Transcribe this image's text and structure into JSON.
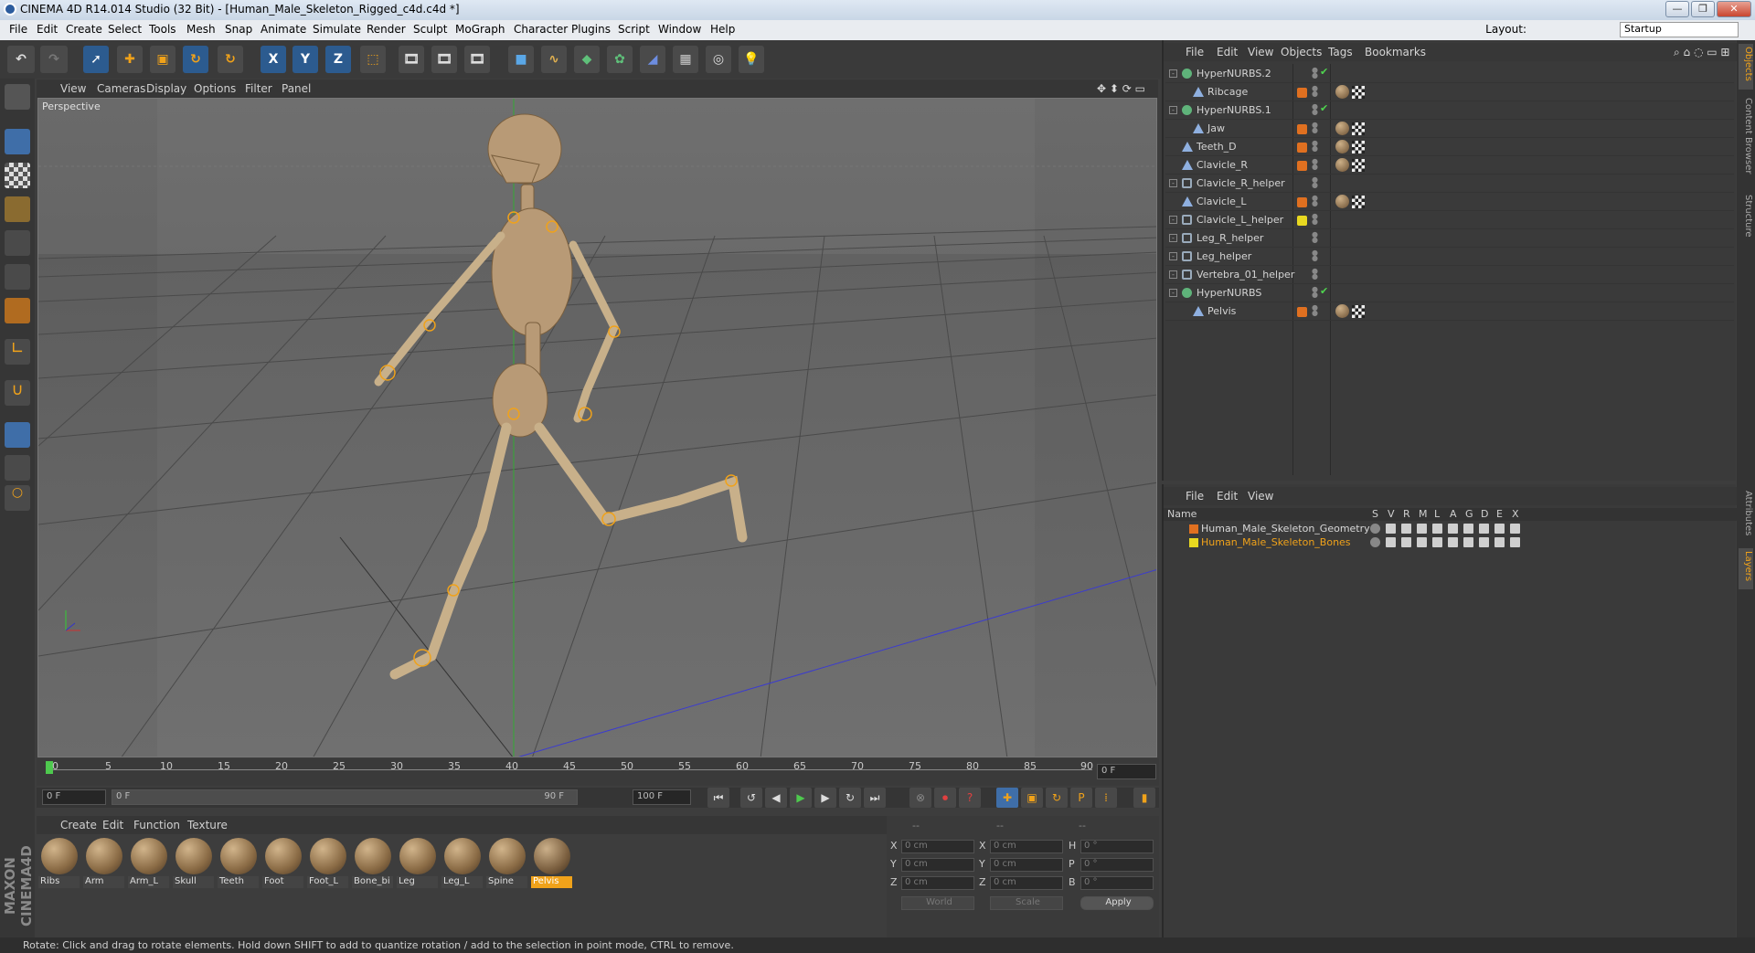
{
  "window": {
    "title": "CINEMA 4D R14.014 Studio (32 Bit) - [Human_Male_Skeleton_Rigged_c4d.c4d *]",
    "minimize": "—",
    "restore": "❐",
    "close": "✕"
  },
  "menubar": {
    "items": [
      "File",
      "Edit",
      "Create",
      "Select",
      "Tools",
      "Mesh",
      "Snap",
      "Animate",
      "Simulate",
      "Render",
      "Sculpt",
      "MoGraph",
      "Character",
      "Plugins",
      "Script",
      "Window",
      "Help"
    ],
    "layout_label": "Layout:",
    "layout_value": "Startup"
  },
  "toolbar": {
    "axis_x": "X",
    "axis_y": "Y",
    "axis_z": "Z"
  },
  "viewport": {
    "menu": [
      "View",
      "Cameras",
      "Display",
      "Options",
      "Filter",
      "Panel"
    ],
    "label": "Perspective"
  },
  "timeline": {
    "ticks": [
      "0",
      "5",
      "10",
      "15",
      "20",
      "25",
      "30",
      "35",
      "40",
      "45",
      "50",
      "55",
      "60",
      "65",
      "70",
      "75",
      "80",
      "85",
      "90"
    ],
    "frame_right": "0 F"
  },
  "transport": {
    "current": "0 F",
    "range_start": "0 F",
    "range_end": "90 F",
    "end": "100 F"
  },
  "materials": {
    "menu": [
      "Create",
      "Edit",
      "Function",
      "Texture"
    ],
    "items": [
      "Ribs",
      "Arm",
      "Arm_L",
      "Skull",
      "Teeth",
      "Foot",
      "Foot_L",
      "Bone_bi",
      "Leg",
      "Leg_L",
      "Spine",
      "Pelvis"
    ],
    "selected": "Pelvis"
  },
  "coords": {
    "header1": "--",
    "header2": "--",
    "header3": "--",
    "x": "X",
    "y": "Y",
    "z": "Z",
    "x2": "X",
    "y2": "Y",
    "z2": "Z",
    "h": "H",
    "p": "P",
    "b": "B",
    "px": "0 cm",
    "py": "0 cm",
    "pz": "0 cm",
    "sx": "0 cm",
    "sy": "0 cm",
    "sz": "0 cm",
    "rh": "0 °",
    "rp": "0 °",
    "rb": "0 °",
    "world": "World",
    "scale": "Scale",
    "apply": "Apply"
  },
  "objects": {
    "menu": [
      "File",
      "Edit",
      "View",
      "Objects",
      "Tags",
      "Bookmarks"
    ],
    "rows": [
      {
        "name": "HyperNURBS.2",
        "type": "nurbs",
        "color": "",
        "check": "✔",
        "tags": false
      },
      {
        "name": "Ribcage",
        "type": "bone",
        "color": "#e07020",
        "check": "",
        "tags": true
      },
      {
        "name": "HyperNURBS.1",
        "type": "nurbs",
        "color": "",
        "check": "✔",
        "tags": false
      },
      {
        "name": "Jaw",
        "type": "bone",
        "color": "#e07020",
        "check": "",
        "tags": true
      },
      {
        "name": "Teeth_D",
        "type": "bone",
        "color": "#e07020",
        "check": "",
        "tags": true
      },
      {
        "name": "Clavicle_R",
        "type": "bone",
        "color": "#e07020",
        "check": "",
        "tags": true
      },
      {
        "name": "Clavicle_R_helper",
        "type": "null",
        "color": "",
        "check": "",
        "tags": false
      },
      {
        "name": "Clavicle_L",
        "type": "bone",
        "color": "#e07020",
        "check": "",
        "tags": true
      },
      {
        "name": "Clavicle_L_helper",
        "type": "null",
        "color": "#e8d820",
        "check": "",
        "tags": false
      },
      {
        "name": "Leg_R_helper",
        "type": "null",
        "color": "",
        "check": "",
        "tags": false
      },
      {
        "name": "Leg_helper",
        "type": "null",
        "color": "",
        "check": "",
        "tags": false
      },
      {
        "name": "Vertebra_01_helper",
        "type": "null",
        "color": "",
        "check": "",
        "tags": false
      },
      {
        "name": "HyperNURBS",
        "type": "nurbs",
        "color": "",
        "check": "✔",
        "tags": false
      },
      {
        "name": "Pelvis",
        "type": "bone",
        "color": "#e07020",
        "check": "",
        "tags": true
      }
    ]
  },
  "layers": {
    "menu": [
      "File",
      "Edit",
      "View"
    ],
    "head_name": "Name",
    "head_cols": [
      "S",
      "V",
      "R",
      "M",
      "L",
      "A",
      "G",
      "D",
      "E",
      "X"
    ],
    "rows": [
      {
        "name": "Human_Male_Skeleton_Geometry",
        "color": "#e07020",
        "textcolor": "#d8d8d8"
      },
      {
        "name": "Human_Male_Skeleton_Bones",
        "color": "#e8d820",
        "textcolor": "#f0a21a"
      }
    ]
  },
  "sidetabs": [
    "Objects",
    "Content Browser",
    "Structure",
    "Attributes",
    "Layers"
  ],
  "status": "Rotate: Click and drag to rotate elements. Hold down SHIFT to add to quantize rotation / add to the selection in point mode, CTRL to remove."
}
